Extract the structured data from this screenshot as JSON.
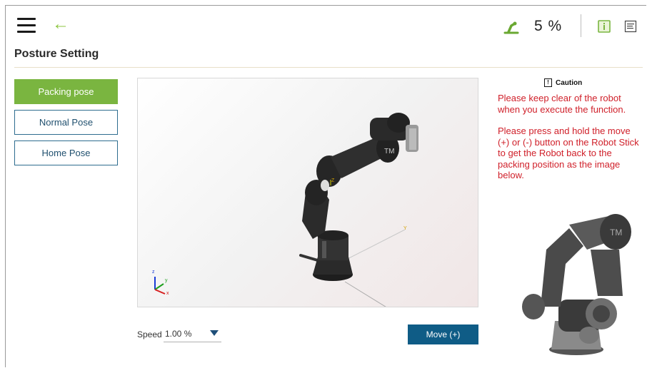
{
  "header": {
    "speed_percent": "5 %",
    "icons": [
      "menu-icon",
      "back-arrow-icon",
      "robot-status-icon",
      "info-icon",
      "notes-icon"
    ]
  },
  "page": {
    "title": "Posture Setting"
  },
  "poses": [
    {
      "label": "Packing pose",
      "active": true
    },
    {
      "label": "Normal Pose",
      "active": false
    },
    {
      "label": "Home Pose",
      "active": false
    }
  ],
  "viewer": {
    "axis_labels": {
      "x": "x",
      "y": "y",
      "z": "z"
    }
  },
  "controls": {
    "speed_label": "Speed",
    "speed_value": "1.00 %",
    "move_button": "Move (+)"
  },
  "caution": {
    "title": "Caution",
    "icon_glyph": "!",
    "line1": "Please keep clear of the robot when you execute the function.",
    "line2": "Please press and hold the move (+) or (-) button on the Robot Stick to get the Robot back to the packing  position as the image below."
  },
  "colors": {
    "accent_green": "#7ab540",
    "button_blue": "#0f5c86",
    "caution_red": "#d0202a"
  }
}
